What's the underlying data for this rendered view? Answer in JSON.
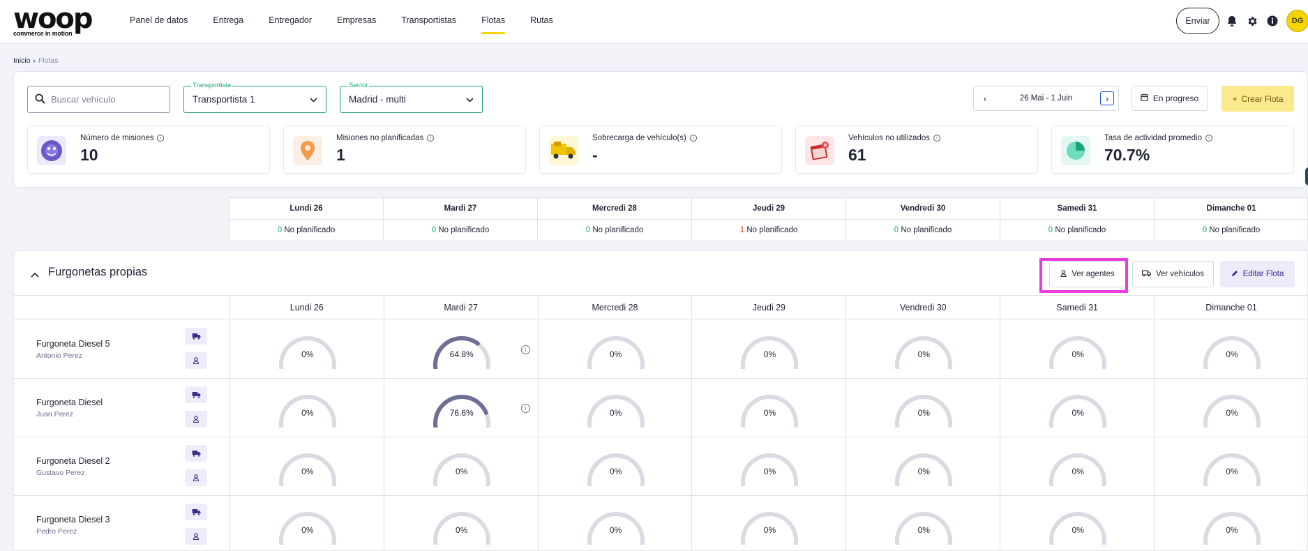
{
  "app": {
    "logo_text": "woop",
    "logo_tagline": "commerce in motion"
  },
  "nav": {
    "items": [
      {
        "label": "Panel de datos",
        "active": false
      },
      {
        "label": "Entrega",
        "active": false
      },
      {
        "label": "Entregador",
        "active": false
      },
      {
        "label": "Empresas",
        "active": false
      },
      {
        "label": "Transportistas",
        "active": false
      },
      {
        "label": "Flotas",
        "active": true
      },
      {
        "label": "Rutas",
        "active": false
      }
    ],
    "send_label": "Enviar",
    "user_initials": "DG",
    "accent": "#f5d400"
  },
  "breadcrumb": {
    "home": "Inicio",
    "current": "Flotas"
  },
  "filters": {
    "search_placeholder": "Buscar vehículo",
    "carrier_label": "Transportista",
    "carrier_value": "Transportista 1",
    "sector_label": "Sector",
    "sector_value": "Madrid - multi",
    "date_range": "26 Mai - 1 Juin",
    "status_label": "En progreso",
    "create_label": "Crear Flota"
  },
  "kpis": [
    {
      "title": "Número de misiones",
      "value": "10",
      "icon": "missions-icon",
      "bg": "#ebe9fb"
    },
    {
      "title": "Misiones no planificadas",
      "value": "1",
      "icon": "map-pin-icon",
      "bg": "#fdeee4"
    },
    {
      "title": "Sobrecarga de vehículo(s)",
      "value": "-",
      "icon": "truck-icon",
      "bg": "#fff7d6"
    },
    {
      "title": "Vehículos no utilizados",
      "value": "61",
      "icon": "calendar-icon",
      "bg": "#fde6e6"
    },
    {
      "title": "Tasa de actividad promedio",
      "value": "70.7%",
      "icon": "pie-chart-icon",
      "bg": "#e4f7f2"
    }
  ],
  "summary": {
    "days": [
      {
        "day": "Lundi 26",
        "count": "0",
        "status": "zero"
      },
      {
        "day": "Mardi 27",
        "count": "0",
        "status": "zero"
      },
      {
        "day": "Mercredi 28",
        "count": "0",
        "status": "zero"
      },
      {
        "day": "Jeudi 29",
        "count": "1",
        "status": "nonzero"
      },
      {
        "day": "Vendredi 30",
        "count": "0",
        "status": "zero"
      },
      {
        "day": "Samedi 31",
        "count": "0",
        "status": "zero"
      },
      {
        "day": "Dimanche 01",
        "count": "0",
        "status": "zero"
      }
    ],
    "unplanned_label": "No planificado"
  },
  "fleet": {
    "title": "Furgonetas propias",
    "view_agents_label": "Ver agentes",
    "view_vehicles_label": "Ver vehículos",
    "edit_label": "Editar Flota",
    "days": [
      "Lundi 26",
      "Mardi 27",
      "Mercredi 28",
      "Jeudi 29",
      "Vendredi 30",
      "Samedi 31",
      "Dimanche 01"
    ],
    "rows": [
      {
        "vehicle": "Furgoneta Diesel 5",
        "agent": "Antonio Perez",
        "values": [
          0,
          64.8,
          0,
          0,
          0,
          0,
          0
        ],
        "labels": [
          "0%",
          "64.8%",
          "0%",
          "0%",
          "0%",
          "0%",
          "0%"
        ]
      },
      {
        "vehicle": "Furgoneta Diesel",
        "agent": "Juan Perez",
        "values": [
          0,
          76.6,
          0,
          0,
          0,
          0,
          0
        ],
        "labels": [
          "0%",
          "76.6%",
          "0%",
          "0%",
          "0%",
          "0%",
          "0%"
        ]
      },
      {
        "vehicle": "Furgoneta Diesel 2",
        "agent": "Gustavo Perez",
        "values": [
          0,
          0,
          0,
          0,
          0,
          0,
          0
        ],
        "labels": [
          "0%",
          "0%",
          "0%",
          "0%",
          "0%",
          "0%",
          "0%"
        ]
      },
      {
        "vehicle": "Furgoneta Diesel 3",
        "agent": "Pedro Perez",
        "values": [
          0,
          0,
          0,
          0,
          0,
          0,
          0
        ],
        "labels": [
          "0%",
          "0%",
          "0%",
          "0%",
          "0%",
          "0%",
          "0%"
        ]
      }
    ],
    "gauge_colors": {
      "track": "#d9dbe3",
      "fill": "#6e6f94"
    }
  }
}
